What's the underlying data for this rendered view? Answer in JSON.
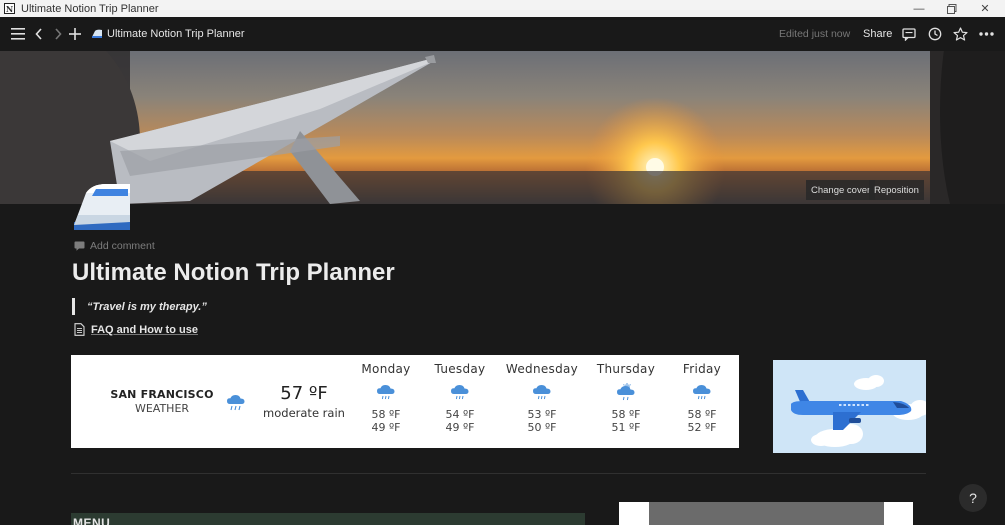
{
  "window": {
    "title": "Ultimate Notion Trip Planner",
    "app_icon_glyph": "N"
  },
  "topbar": {
    "breadcrumb": "Ultimate Notion Trip Planner",
    "edited": "Edited just now",
    "share_label": "Share"
  },
  "cover": {
    "change_cover": "Change cover",
    "reposition": "Reposition"
  },
  "page": {
    "add_comment": "Add comment",
    "title": "Ultimate Notion Trip Planner",
    "quote": "“Travel is my therapy.”",
    "faq_link": "FAQ and How to use"
  },
  "weather": {
    "city": "SAN FRANCISCO",
    "label": "WEATHER",
    "current_temp": "57 ºF",
    "current_desc": "moderate rain",
    "days": [
      {
        "name": "Monday",
        "high": "58 ºF",
        "low": "49 ºF",
        "icon": "rain-cloud-icon"
      },
      {
        "name": "Tuesday",
        "high": "54 ºF",
        "low": "49 ºF",
        "icon": "rain-cloud-icon"
      },
      {
        "name": "Wednesday",
        "high": "53 ºF",
        "low": "50 ºF",
        "icon": "rain-cloud-icon"
      },
      {
        "name": "Thursday",
        "high": "58 ºF",
        "low": "51 ºF",
        "icon": "sun-rain-cloud-icon"
      },
      {
        "name": "Friday",
        "high": "58 ºF",
        "low": "52 ºF",
        "icon": "rain-cloud-icon"
      }
    ]
  },
  "sections": {
    "menu_heading": "MENU"
  },
  "help": {
    "label": "?"
  },
  "colors": {
    "background": "#191919",
    "weather_icon": "#4a90d9",
    "menu_block": "#2c3b31"
  }
}
